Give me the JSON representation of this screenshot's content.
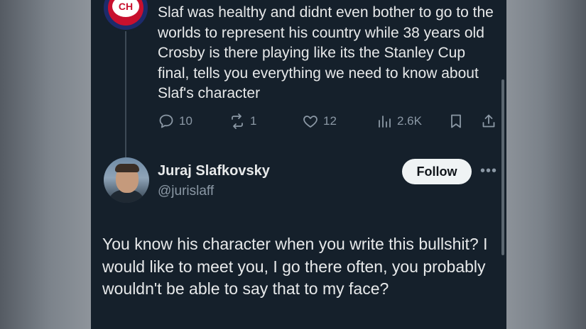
{
  "original_tweet": {
    "avatar_text": "CH",
    "text": "Slaf was healthy and didnt even bother to go to the worlds to represent his country while 38 years old Crosby is there playing like its the Stanley Cup final, tells you everything we need to know about Slaf's character",
    "actions": {
      "replies": "10",
      "reposts": "1",
      "likes": "12",
      "views": "2.6K"
    }
  },
  "reply": {
    "name": "Juraj Slafkovsky",
    "handle": "@jurislaff",
    "follow_label": "Follow",
    "more_label": "•••",
    "text": "You know his character when you write this bullshit? I would like to meet you, I go there often, you probably wouldn't be able to say that to my face?"
  },
  "colors": {
    "background": "#15202b",
    "text": "#e7e9ea",
    "muted": "#8b98a5",
    "follow_bg": "#eff3f4"
  }
}
